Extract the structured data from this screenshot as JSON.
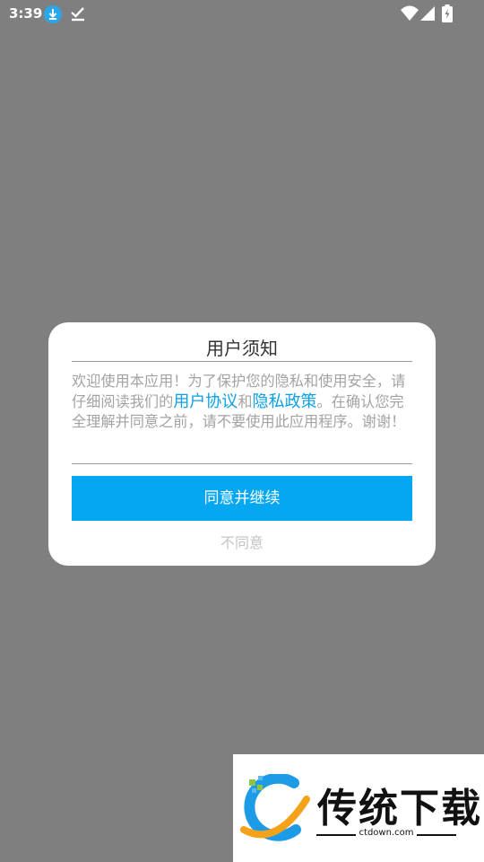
{
  "status_bar": {
    "time": "3:39",
    "icons": [
      "download-icon",
      "check-icon",
      "wifi-icon",
      "signal-icon",
      "battery-icon"
    ]
  },
  "dialog": {
    "title": "用户须知",
    "body": {
      "text_1": "欢迎使用本应用！为了保护您的隐私和使用安全，请仔细阅读我们的",
      "link_terms": "用户协议",
      "text_2": "和",
      "link_privacy": "隐私政策",
      "text_3": "。在确认您完全理解并同意之前，请不要使用此应用程序。谢谢！"
    },
    "agree_label": "同意并继续",
    "disagree_label": "不同意"
  },
  "watermark": {
    "brand": "传统下载",
    "domain": "ctdown.com"
  },
  "colors": {
    "overlay": "#7f7f7f",
    "accent": "#05a7f1",
    "link": "#0aa0e6",
    "body_text": "#a3a3a3"
  }
}
